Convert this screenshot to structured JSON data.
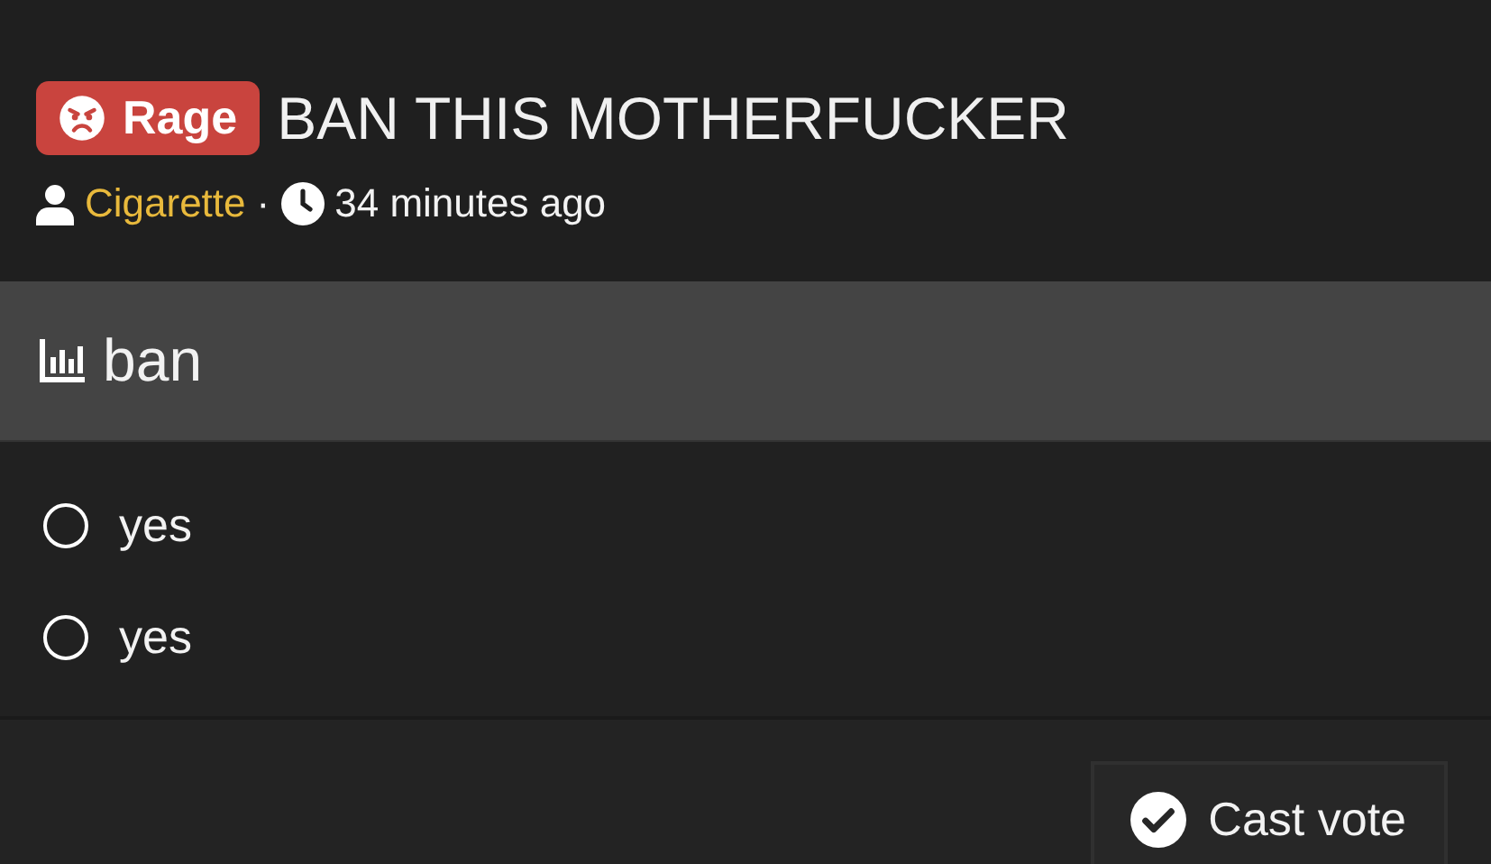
{
  "post": {
    "badge": {
      "label": "Rage",
      "color": "#c9443e"
    },
    "title": "BAN THIS MOTHERFUCKER",
    "author": "Cigarette",
    "separator": "·",
    "time": "34 minutes ago"
  },
  "poll": {
    "title": "ban",
    "options": [
      {
        "label": "yes",
        "selected": false
      },
      {
        "label": "yes",
        "selected": false
      }
    ],
    "button": "Cast vote"
  }
}
